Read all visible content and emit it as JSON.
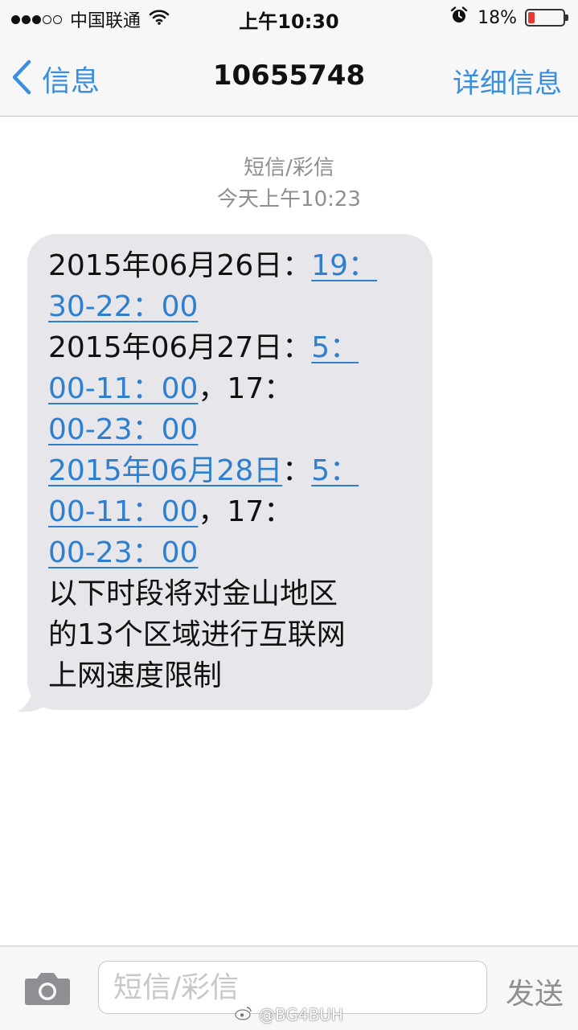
{
  "status_bar": {
    "carrier": "中国联通",
    "time": "上午10:30",
    "battery_percent": "18%",
    "battery_level": 0.18,
    "signal_bars": 3,
    "signal_total": 5,
    "battery_color": "#e53935",
    "icons": [
      "signal-dots-icon",
      "wifi-icon",
      "alarm-icon",
      "battery-icon"
    ]
  },
  "nav": {
    "back_label": "信息",
    "title": "10655748",
    "details_label": "详细信息",
    "accent_color": "#3a8ee0"
  },
  "conversation": {
    "message_type": "短信/彩信",
    "timestamp": "今天上午10:23",
    "bubble_color": "#e6e6eb",
    "link_color": "#2e7fcf",
    "message_lines": [
      [
        {
          "text": "2015年06月26日：",
          "link": false
        },
        {
          "text": "19：",
          "link": true
        }
      ],
      [
        {
          "text": "30-22：00",
          "link": true
        }
      ],
      [
        {
          "text": "2015年06月27日：",
          "link": false
        },
        {
          "text": "5：",
          "link": true
        }
      ],
      [
        {
          "text": "00-11：00",
          "link": true
        },
        {
          "text": "，17：",
          "link": false
        }
      ],
      [
        {
          "text": "00-23：00",
          "link": true
        }
      ],
      [
        {
          "text": "2015年06月28日",
          "link": true
        },
        {
          "text": "：",
          "link": false
        },
        {
          "text": "5：",
          "link": true
        }
      ],
      [
        {
          "text": "00-11：00",
          "link": true
        },
        {
          "text": "，17：",
          "link": false
        }
      ],
      [
        {
          "text": "00-23：00",
          "link": true
        }
      ],
      [
        {
          "text": "以下时段将对金山地区",
          "link": false
        }
      ],
      [
        {
          "text": "的13个区域进行互联网",
          "link": false
        }
      ],
      [
        {
          "text": "上网速度限制",
          "link": false
        }
      ]
    ]
  },
  "input_bar": {
    "placeholder": "短信/彩信",
    "send_label": "发送",
    "camera_icon": "camera-icon"
  },
  "watermark": {
    "text": "@BG4BUH",
    "icon": "weibo-icon"
  }
}
